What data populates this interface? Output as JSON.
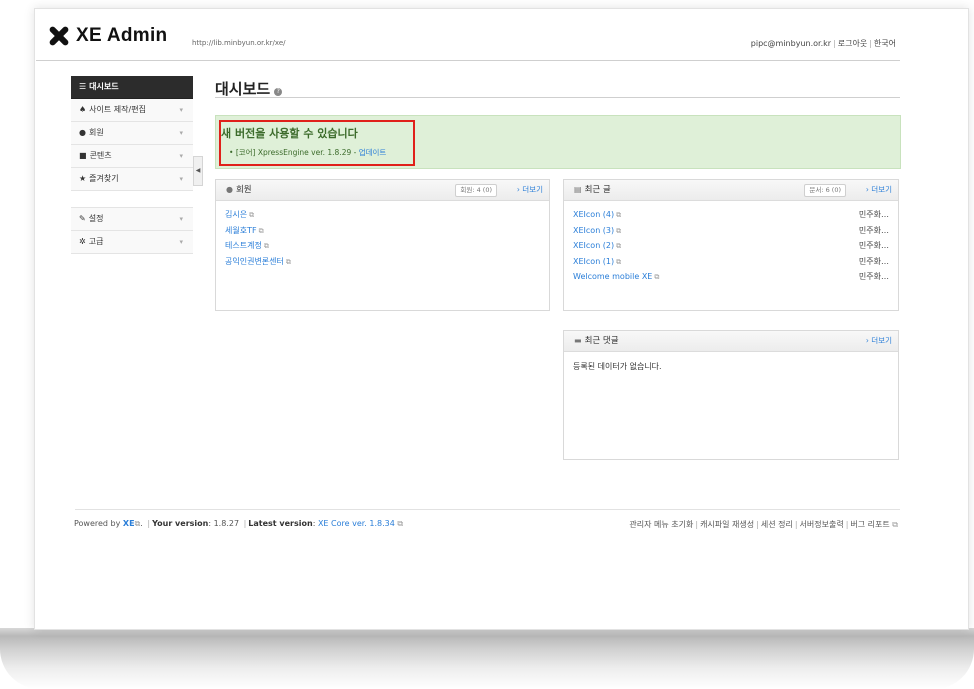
{
  "header": {
    "logo_text": "XE Admin",
    "site_url": "http://lib.minbyun.or.kr/xe/",
    "user_email": "pipc@minbyun.or.kr",
    "logout_label": "로그아웃",
    "language_label": "한국어"
  },
  "sidebar": {
    "items": [
      {
        "label": "대시보드",
        "icon": "grid-icon",
        "active": true
      },
      {
        "label": "사이트 제작/편집",
        "icon": "home-icon"
      },
      {
        "label": "회원",
        "icon": "user-icon"
      },
      {
        "label": "콘텐츠",
        "icon": "document-icon"
      },
      {
        "label": "즐겨찾기",
        "icon": "star-icon"
      },
      {
        "label": "설정",
        "icon": "wrench-icon"
      },
      {
        "label": "고급",
        "icon": "gear-icon"
      }
    ],
    "toggle_glyph": "◀"
  },
  "page": {
    "title": "대시보드"
  },
  "update_notice": {
    "title": "새 버전을 사용할 수 있습니다",
    "item_text": "[코어] XpressEngine ver. 1.8.29 - ",
    "item_link": "업데이트"
  },
  "members_panel": {
    "title": "회원",
    "count": "회원: 4 (0)",
    "more": "› 더보기",
    "members": [
      "김시은",
      "세월호TF",
      "테스트계정",
      "공익인권변론센터"
    ]
  },
  "recent_posts_panel": {
    "title": "최근 글",
    "count": "문서: 6 (0)",
    "more": "› 더보기",
    "posts": [
      {
        "title": "XEIcon (4)",
        "author": "민주화…"
      },
      {
        "title": "XEIcon (3)",
        "author": "민주화…"
      },
      {
        "title": "XEIcon (2)",
        "author": "민주화…"
      },
      {
        "title": "XEIcon (1)",
        "author": "민주화…"
      },
      {
        "title": "Welcome mobile XE",
        "author": "민주화…"
      }
    ]
  },
  "recent_comments_panel": {
    "title": "최근 댓글",
    "more": "› 더보기",
    "empty_message": "등록된 데이터가 없습니다."
  },
  "footer": {
    "powered_by": "Powered by",
    "xe_link": "XE",
    "your_version_label": "Your version",
    "your_version": "1.8.27",
    "latest_version_label": "Latest version",
    "latest_version": "XE Core ver. 1.8.34",
    "links": [
      "관리자 메뉴 초기화",
      "캐시파일 재생성",
      "세션 정리",
      "서버정보출력",
      "버그 리포트"
    ]
  },
  "colors": {
    "link": "#2a7ed8",
    "highlight_border": "#e0201a",
    "notice_background": "#dff0d8",
    "active_nav": "#2c2c2c"
  }
}
